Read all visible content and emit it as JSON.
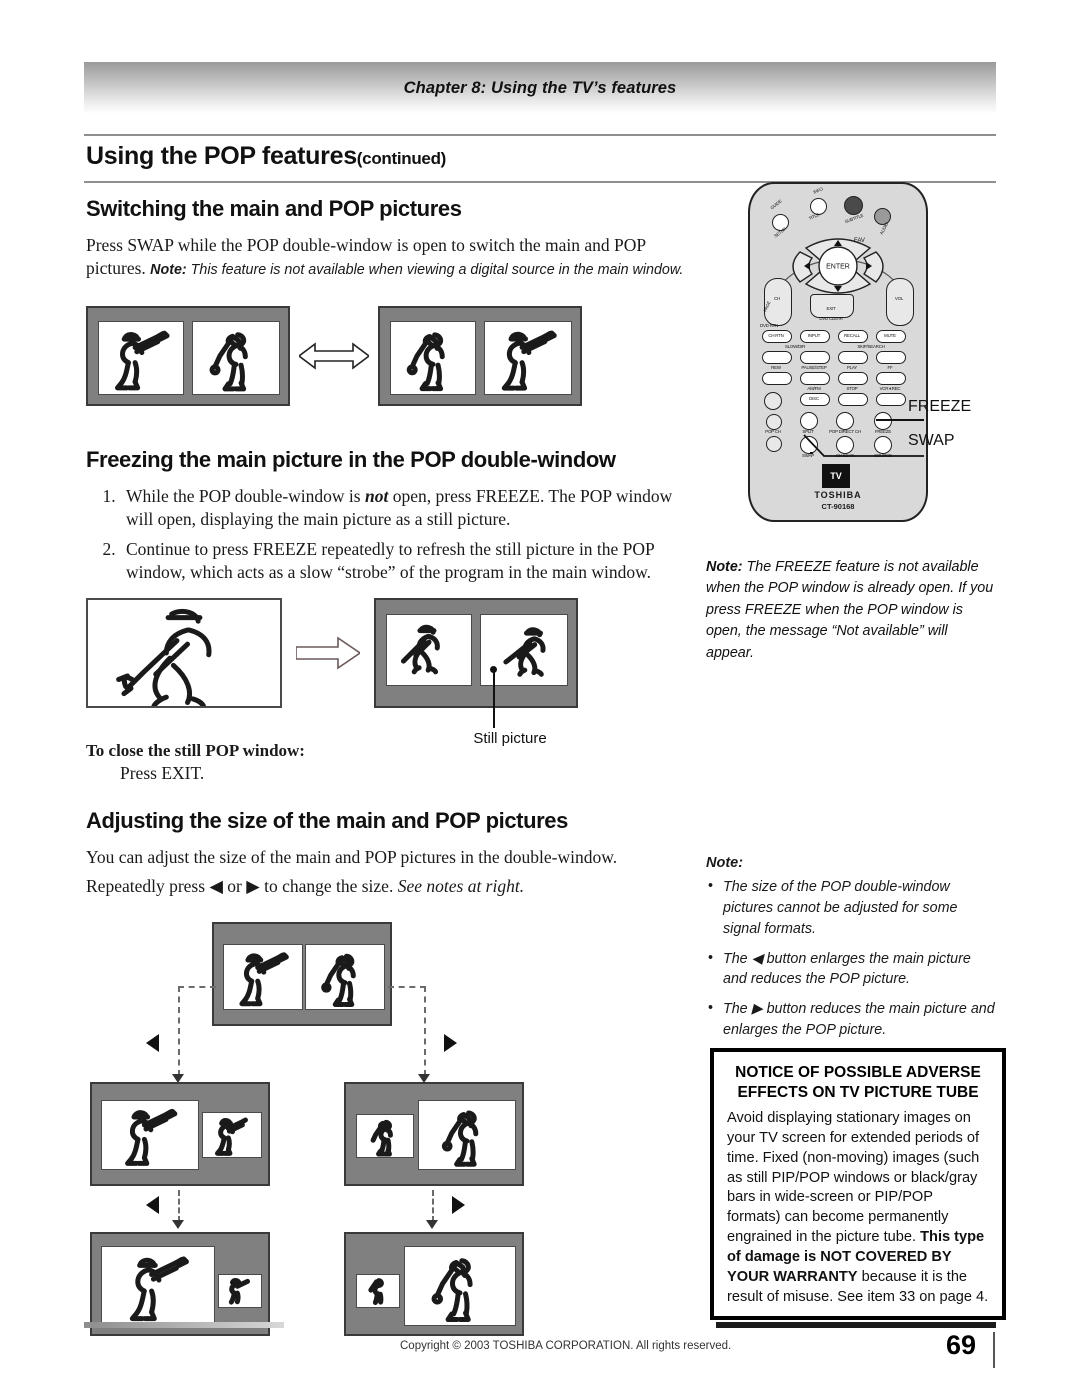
{
  "header": {
    "chapter": "Chapter 8: Using the TV’s features"
  },
  "title": {
    "main": "Using the POP features",
    "continued": "(continued)"
  },
  "sections": {
    "swap": {
      "heading": "Switching the main and POP pictures",
      "body_lead": "Press SWAP while the POP double-window is open to switch the main and POP pictures.",
      "note_label": "Note:",
      "note_text": "This feature is not available when viewing a digital source in the main window."
    },
    "freeze": {
      "heading": "Freezing the main picture in the POP double-window",
      "steps": [
        {
          "pre": "While the POP double-window is ",
          "em": "not",
          "post": " open, press FREEZE. The POP window will open, displaying the main picture as a still picture."
        },
        {
          "pre": "Continue to press FREEZE repeatedly to refresh the still picture in the POP window, which acts as a slow “strobe” of the program in the main window.",
          "em": "",
          "post": ""
        }
      ],
      "still_label": "Still picture",
      "close_heading": "To close the still POP window:",
      "close_text": "Press EXIT."
    },
    "adjust": {
      "heading": "Adjusting the size of the main and POP pictures",
      "body_1": "You can adjust the size of the main and POP pictures in the double-window.",
      "body_2_pre": "Repeatedly press ",
      "body_2_mid": " or ",
      "body_2_post": " to change the size. ",
      "body_2_em": "See notes at right."
    }
  },
  "right": {
    "freeze_note": {
      "label": "Note:",
      "text": "The FREEZE feature is not available when the POP window is already open. If you press FREEZE when the POP window is open, the message “Not available” will appear."
    },
    "adjust_note": {
      "label": "Note:",
      "bullets": [
        "The size of the POP double-window pictures cannot be adjusted for some signal formats.",
        "The ◀ button enlarges the main picture and reduces the POP picture.",
        "The ▶ button reduces the main picture and enlarges the POP picture."
      ]
    },
    "notice": {
      "title_line_1": "NOTICE OF POSSIBLE ADVERSE",
      "title_line_2": "EFFECTS ON TV PICTURE TUBE",
      "body_part_1": "Avoid displaying stationary images on your TV screen for extended periods of time. Fixed (non-moving) images (such as still PIP/POP windows or black/gray bars in wide-screen or PIP/POP formats) can become permanently engrained in the picture tube. ",
      "body_bold_1": "This type of damage is NOT COVERED BY YOUR WARRANTY",
      "body_part_2": " because it is the result of misuse. See item 33 on page 4."
    }
  },
  "remote": {
    "brand": "TOSHIBA",
    "model": "CT-90168",
    "callouts": {
      "freeze": "FREEZE",
      "swap": "SWAP"
    },
    "top_buttons": [
      "GUIDE",
      "SETUP",
      "INFO",
      "TITLE",
      "SUBTITLE",
      "AUDIO"
    ],
    "nav": {
      "center": "ENTER",
      "up_label": "FAV",
      "exit": "EXIT",
      "exit_sub": "DVD CLEAR",
      "ch": "CH",
      "vol": "VOL",
      "page": "PAGE"
    },
    "row_1": [
      "CH RTN",
      "INPUT",
      "RECALL",
      "MUTE"
    ],
    "row_1_sub": "DVD RTN",
    "group_labels": {
      "slow": "SLOW/DIR",
      "skip": "SKIP/SEARCH",
      "rew": "REW",
      "pause": "PAUSE/STEP",
      "play": "PLAY",
      "ff": "FF",
      "amfm": "AM/FM",
      "stop": "STOP",
      "vcrrec": "VCR∗REC",
      "disc": "DISC",
      "tvvcr": "TV/VCR"
    },
    "pop_row_1": [
      "SPLIT",
      "POP DIRECT CH",
      "FREEZE"
    ],
    "pop_row_2": [
      "SWAP",
      "CH SCAN",
      "SOURCE"
    ],
    "pop_ch": "POP CH",
    "tv_logo": "TV"
  },
  "footer": {
    "copyright": "Copyright © 2003 TOSHIBA CORPORATION. All rights reserved.",
    "page_number": "69"
  },
  "colors": {
    "bezel": "#808080",
    "rule": "#8f8f8f",
    "ink": "#1a1a1a"
  }
}
